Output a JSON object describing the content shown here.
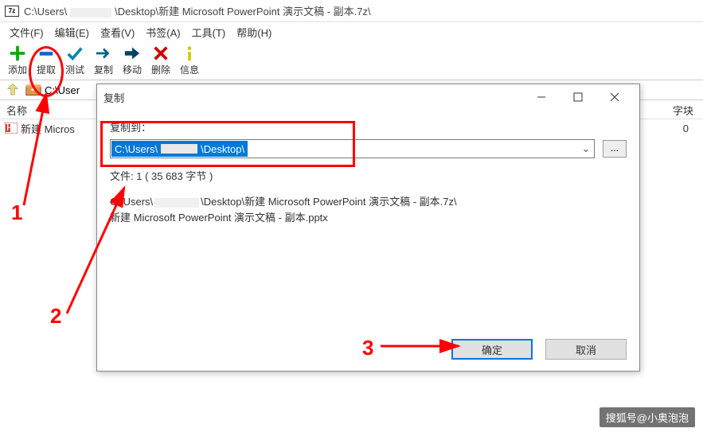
{
  "titlebar": {
    "app_icon_text": "7z",
    "path_before": "C:\\Users\\",
    "path_after": "\\Desktop\\新建 Microsoft PowerPoint 演示文稿 - 副本.7z\\"
  },
  "menubar": {
    "items": [
      "文件(F)",
      "编辑(E)",
      "查看(V)",
      "书签(A)",
      "工具(T)",
      "帮助(H)"
    ]
  },
  "toolbar": {
    "add": "添加",
    "extract": "提取",
    "test": "测试",
    "copy": "复制",
    "move": "移动",
    "delete": "删除",
    "info": "信息"
  },
  "addrbar": {
    "text": "C:\\User"
  },
  "columns": {
    "name": "名称",
    "size": "字块"
  },
  "row": {
    "name": "新建 Micros",
    "size": "0"
  },
  "dialog": {
    "title": "复制",
    "label": "复制到：",
    "dest_before": "C:\\Users\\",
    "dest_after": "\\Desktop\\",
    "file_info": "文件: 1   ( 35 683 字节 )",
    "path_line_before": "C:\\Users\\",
    "path_line_after": "\\Desktop\\新建 Microsoft PowerPoint 演示文稿 - 副本.7z\\",
    "path_line2": "新建 Microsoft PowerPoint 演示文稿 - 副本.pptx",
    "ok": "确定",
    "cancel": "取消",
    "browse": "..."
  },
  "annotations": {
    "a1": "1",
    "a2": "2",
    "a3": "3"
  },
  "watermark": "搜狐号@小奥泡泡"
}
